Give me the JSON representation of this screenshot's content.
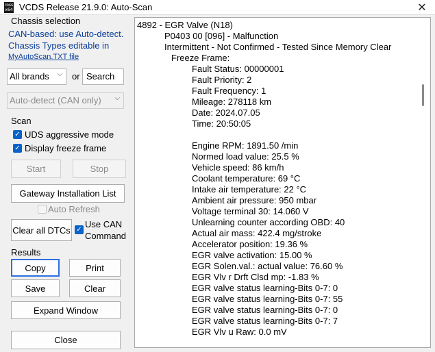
{
  "window": {
    "title": "VCDS Release 21.9.0:  Auto-Scan",
    "icon_text": "ross\nx64"
  },
  "chassis": {
    "heading": "Chassis selection",
    "info_line1": "CAN-based: use Auto-detect.",
    "info_line2": "Chassis Types editable in",
    "file_link": "MyAutoScan.TXT file",
    "brand_value": "All brands",
    "or_label": "or",
    "search_label": "Search",
    "detect_value": "Auto-detect (CAN only)"
  },
  "scan": {
    "heading": "Scan",
    "uds_label": "UDS aggressive mode",
    "uds_checked": true,
    "freeze_label": "Display freeze frame",
    "freeze_checked": true,
    "start_label": "Start",
    "stop_label": "Stop",
    "gateway_label": "Gateway Installation List",
    "auto_refresh_label": "Auto Refresh",
    "auto_refresh_checked": false,
    "clear_dtcs_label": "Clear all DTCs",
    "use_can_line1": "Use CAN",
    "use_can_line2": "Command",
    "use_can_checked": true
  },
  "results": {
    "heading": "Results",
    "copy_label": "Copy",
    "print_label": "Print",
    "save_label": "Save",
    "clear_label": "Clear",
    "expand_label": "Expand Window",
    "close_label": "Close"
  },
  "output": {
    "lines": [
      "4892 - EGR Valve (N18)",
      "P0403 00 [096] - Malfunction",
      "Intermittent - Not Confirmed - Tested Since Memory Clear",
      "Freeze Frame:",
      "Fault Status: 00000001",
      "Fault Priority: 2",
      "Fault Frequency: 1",
      "Mileage: 278118 km",
      "Date: 2024.07.05",
      "Time: 20:50:05",
      "",
      "Engine RPM: 1891.50 /min",
      "Normed load value: 25.5 %",
      "Vehicle speed: 86 km/h",
      "Coolant temperature: 69 °C",
      "Intake air temperature: 22 °C",
      "Ambient air pressure: 950 mbar",
      "Voltage terminal 30: 14.060 V",
      "Unlearning counter according OBD: 40",
      "Actual air mass: 422.4 mg/stroke",
      "Accelerator position: 19.36 %",
      "EGR valve activation: 15.00 %",
      "EGR Solen.val.: actual value: 76.60 %",
      "EGR Vlv r Drft Clsd mp: -1.83 %",
      "EGR valve status learning-Bits 0-7: 0",
      "EGR valve status learning-Bits 0-7: 55",
      "EGR valve status learning-Bits 0-7: 0",
      "EGR valve status learning-Bits 0-7: 7",
      "EGR Vlv u Raw: 0.0 mV"
    ]
  }
}
